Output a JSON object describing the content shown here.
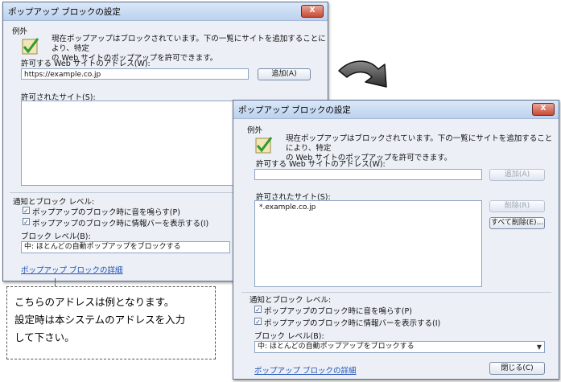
{
  "dialog_back": {
    "title": "ポップアップ ブロックの設定",
    "close_label": "X",
    "section_exceptions": "例外",
    "description_line1": "現在ポップアップはブロックされています。下の一覧にサイトを追加することにより、特定",
    "description_line2": "の Web サイトのポップアップを許可できます。",
    "address_label": "許可する Web サイトのアドレス(W):",
    "address_value": "https://example.co.jp",
    "add_button": "追加(A)",
    "allowed_sites_label": "許可されたサイト(S):",
    "notify_section": "通知とブロック レベル:",
    "checkbox_sound": "ポップアップのブロック時に音を鳴らす(P)",
    "checkbox_infobar": "ポップアップのブロック時に情報バーを表示する(I)",
    "block_level_label": "ブロック レベル(B):",
    "block_level_value": "中: ほとんどの自動ポップアップをブロックする",
    "details_link": "ポップアップ ブロックの詳細"
  },
  "dialog_front": {
    "title": "ポップアップ ブロックの設定",
    "close_label": "X",
    "section_exceptions": "例外",
    "description_line1": "現在ポップアップはブロックされています。下の一覧にサイトを追加することにより、特定",
    "description_line2": "の Web サイトのポップアップを許可できます。",
    "address_label": "許可する Web サイトのアドレス(W):",
    "address_value": "",
    "add_button": "追加(A)",
    "allowed_sites_label": "許可されたサイト(S):",
    "allowed_sites": [
      "*.example.co.jp"
    ],
    "remove_button": "削除(R)",
    "remove_all_button": "すべて削除(E)...",
    "notify_section": "通知とブロック レベル:",
    "checkbox_sound": "ポップアップのブロック時に音を鳴らす(P)",
    "checkbox_infobar": "ポップアップのブロック時に情報バーを表示する(I)",
    "block_level_label": "ブロック レベル(B):",
    "block_level_value": "中: ほとんどの自動ポップアップをブロックする",
    "details_link": "ポップアップ ブロックの詳細",
    "close_button": "閉じる(C)"
  },
  "callout": {
    "line1": "こちらのアドレスは例となります。",
    "line2": "設定時は本システムのアドレスを入力",
    "line3": "して下さい。"
  }
}
